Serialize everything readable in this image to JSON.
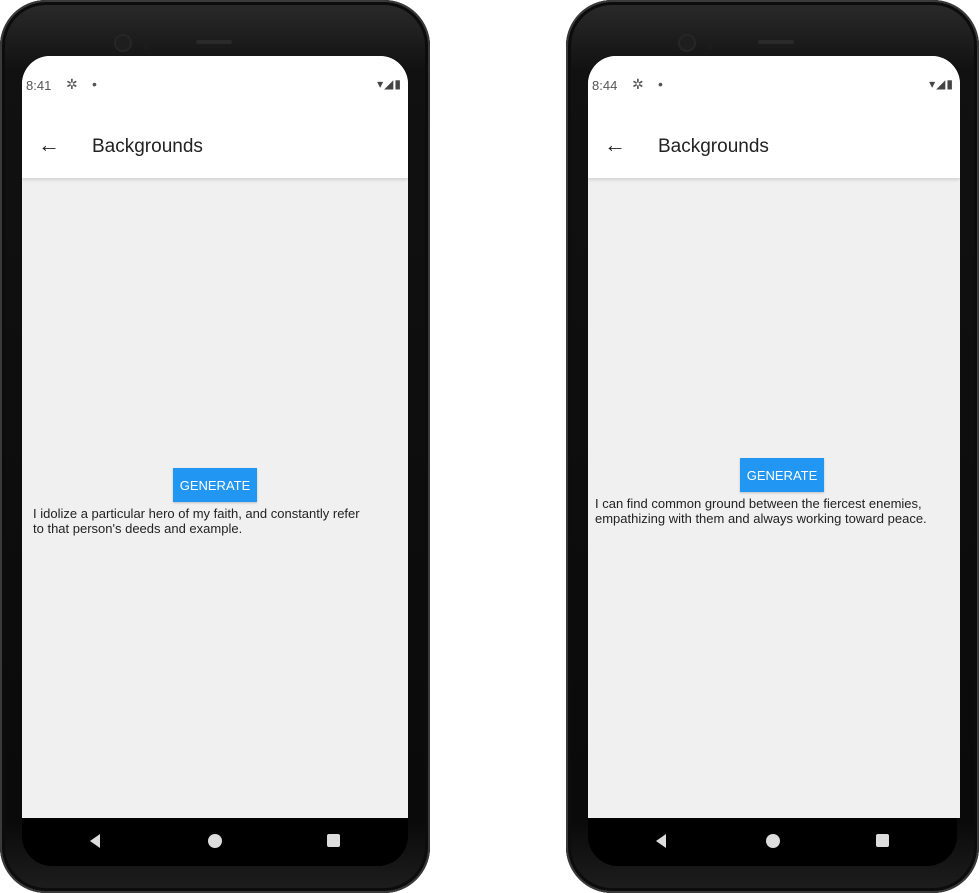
{
  "phones": [
    {
      "status": {
        "time": "8:41",
        "gear_icon": "gear-icon",
        "dot": "•",
        "right_icons": "▾◢▮"
      },
      "app_bar": {
        "back_icon": "←",
        "title": "Backgrounds"
      },
      "button": {
        "label": "GENERATE",
        "color": "#2196f3"
      },
      "result": "I idolize a particular hero of my faith, and constantly refer to that person's deeds and example."
    },
    {
      "status": {
        "time": "8:44",
        "gear_icon": "gear-icon",
        "dot": "•",
        "right_icons": "▾◢▮"
      },
      "app_bar": {
        "back_icon": "←",
        "title": "Backgrounds"
      },
      "button": {
        "label": "GENERATE",
        "color": "#2196f3"
      },
      "result": "I can find common ground between the fiercest enemies, empathizing with them and always working toward peace."
    }
  ]
}
